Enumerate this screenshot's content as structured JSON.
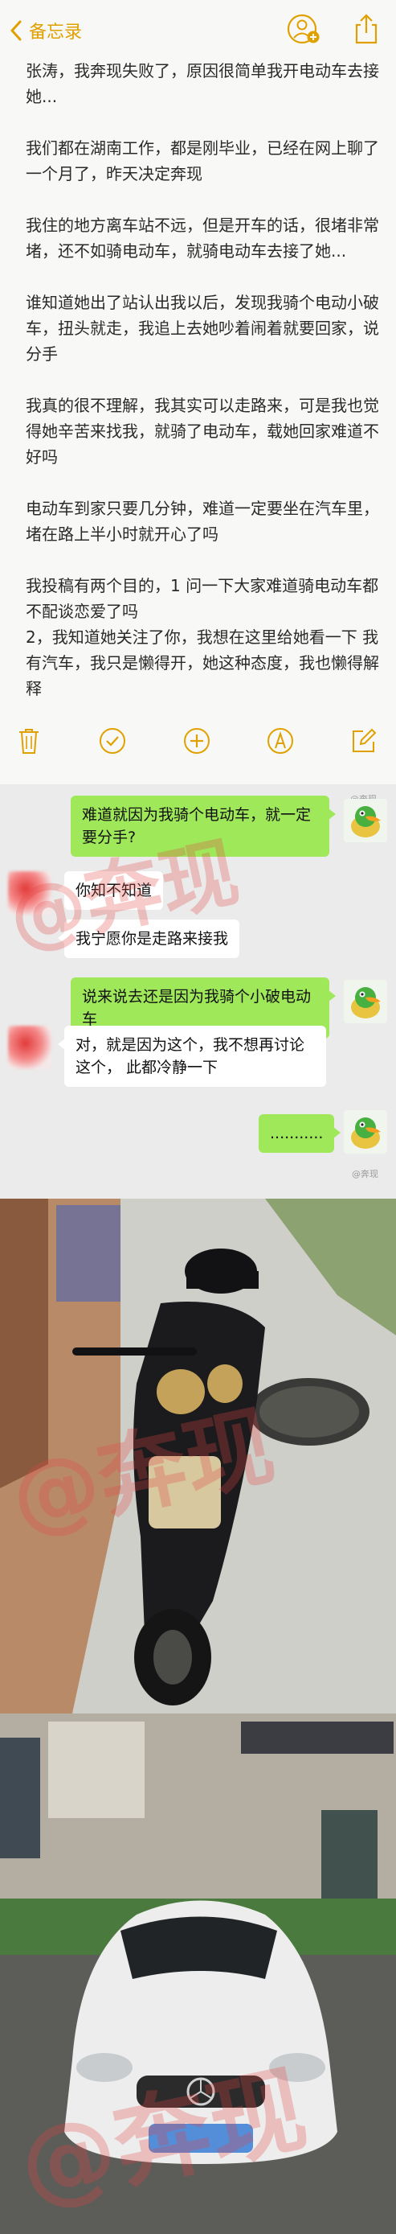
{
  "app": {
    "back_label": "备忘录",
    "accent": "#e0a100"
  },
  "note": {
    "paragraphs": [
      "张涛，我奔现失败了，原因很简单我开电动车去接她...",
      "我们都在湖南工作，都是刚毕业，已经在网上聊了一个月了，昨天决定奔现",
      "我住的地方离车站不远，但是开车的话，很堵非常堵，还不如骑电动车，就骑电动车去接了她...",
      "谁知道她出了站认出我以后，发现我骑个电动小破车，扭头就走，我追上去她吵着闹着就要回家，说分手",
      "我真的很不理解，我其实可以走路来，可是我也觉得她辛苦来找我，就骑了电动车，载她回家难道不好吗",
      "电动车到家只要几分钟，难道一定要坐在汽车里，堵在路上半小时就开心了吗",
      "我投稿有两个目的，1 问一下大家难道骑电动车都不配谈恋爱了吗\n2，我知道她关注了你，我想在这里给她看一下 我有汽车，我只是懒得开，她这种态度，我也懒得解释"
    ],
    "toolbar_icons": [
      "trash-icon",
      "checklist-icon",
      "add-icon",
      "markup-icon",
      "compose-icon"
    ]
  },
  "chat": {
    "messages": [
      {
        "side": "out",
        "text": "难道就因为我骑个电动车，就一定要分手?"
      },
      {
        "side": "in",
        "text": "你知不知道"
      },
      {
        "side": "in",
        "text": "我宁愿你是走路来接我"
      },
      {
        "side": "out",
        "text": "说来说去还是因为我骑个小破电动车"
      },
      {
        "side": "in",
        "text": "对，就是因为这个，我不想再讨论这个，      此都冷静一下"
      },
      {
        "side": "out",
        "text": "..........."
      }
    ],
    "colors": {
      "outgoing": "#9fe85a",
      "incoming": "#ffffff",
      "background": "#ebebeb"
    }
  },
  "watermarks": {
    "big": "@奔现",
    "small": "@奔现"
  },
  "photos": [
    {
      "subject": "black electric scooter parked beside a building"
    },
    {
      "subject": "white Mercedes-Benz SLK convertible with blurred plate"
    }
  ]
}
